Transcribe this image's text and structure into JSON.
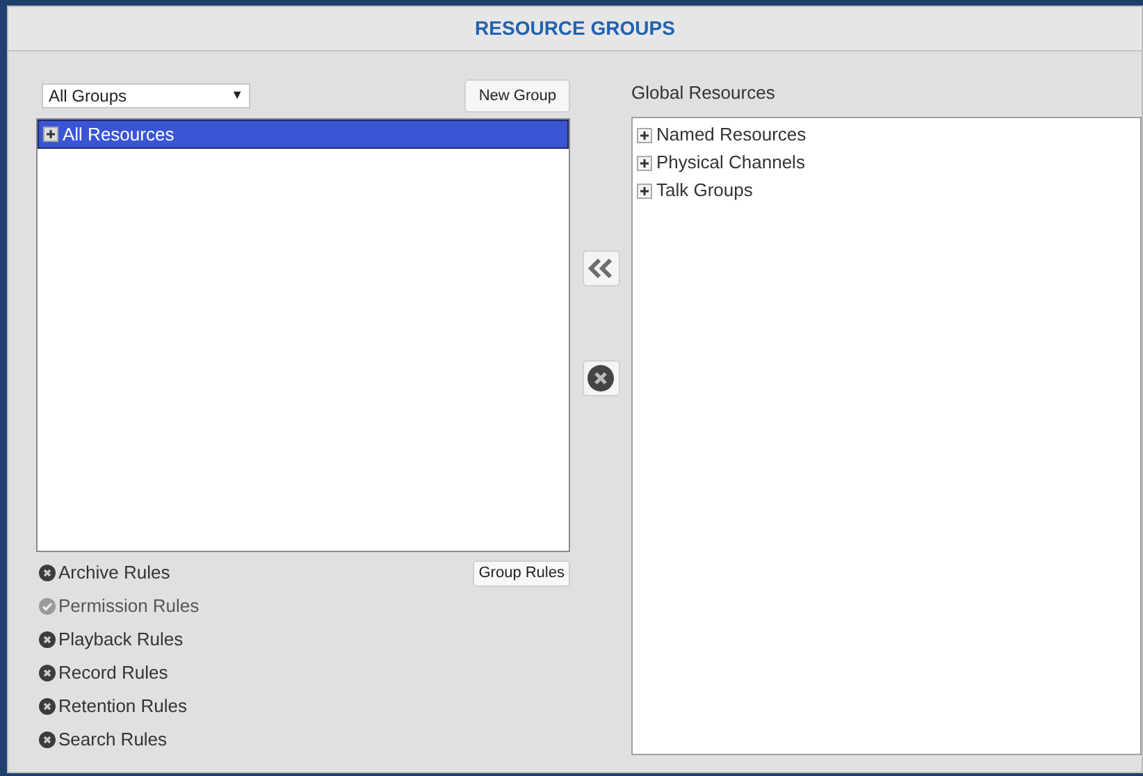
{
  "title": "RESOURCE GROUPS",
  "group_select": {
    "value": "All Groups",
    "arrow": "▼"
  },
  "new_group_button": "New Group",
  "groups_tree": [
    {
      "label": "All Resources",
      "selected": true,
      "expanded": false
    }
  ],
  "group_rules_button": "Group Rules",
  "rules": [
    {
      "label": "Archive Rules",
      "allowed": false
    },
    {
      "label": "Permission Rules",
      "allowed": true
    },
    {
      "label": "Playback Rules",
      "allowed": false
    },
    {
      "label": "Record Rules",
      "allowed": false
    },
    {
      "label": "Retention Rules",
      "allowed": false
    },
    {
      "label": "Search Rules",
      "allowed": false
    }
  ],
  "global_resources": {
    "label": "Global Resources",
    "items": [
      {
        "label": "Named Resources",
        "expanded": false
      },
      {
        "label": "Physical Channels",
        "expanded": false
      },
      {
        "label": "Talk Groups",
        "expanded": false
      }
    ]
  }
}
